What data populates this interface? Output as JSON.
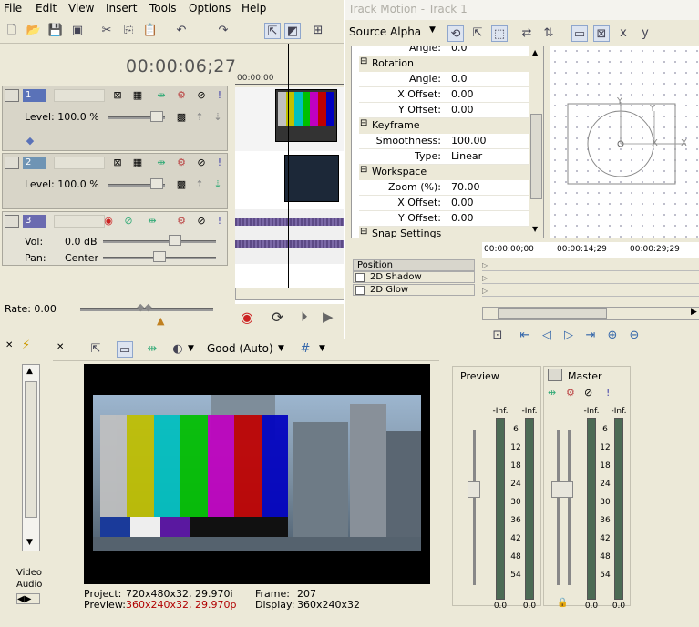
{
  "menu": [
    "File",
    "Edit",
    "View",
    "Insert",
    "Tools",
    "Options",
    "Help"
  ],
  "timecode": "00:00:06;27",
  "tracks": [
    {
      "num": "1",
      "level_label": "Level: 100.0 %",
      "color": "#5a72b8"
    },
    {
      "num": "2",
      "level_label": "Level: 100.0 %",
      "color": "#6f94b4"
    },
    {
      "num": "3",
      "vol_label": "Vol:",
      "vol_value": "0.0 dB",
      "pan_label": "Pan:",
      "pan_value": "Center",
      "color": "#6b6bb0"
    }
  ],
  "rate_label": "Rate: 0.00",
  "ruler_time": "00:00:00",
  "track_motion": {
    "title": "Track Motion - Track 1",
    "source_alpha": "Source Alpha",
    "props": [
      {
        "type": "partial",
        "key": "Angle:",
        "value": "0.0"
      },
      {
        "type": "cat",
        "label": "Rotation"
      },
      {
        "type": "prop",
        "key": "Angle:",
        "value": "0.0"
      },
      {
        "type": "prop",
        "key": "X Offset:",
        "value": "0.00"
      },
      {
        "type": "prop",
        "key": "Y Offset:",
        "value": "0.00"
      },
      {
        "type": "cat",
        "label": "Keyframe"
      },
      {
        "type": "prop",
        "key": "Smoothness:",
        "value": "100.00"
      },
      {
        "type": "prop",
        "key": "Type:",
        "value": "Linear"
      },
      {
        "type": "cat",
        "label": "Workspace"
      },
      {
        "type": "prop",
        "key": "Zoom (%):",
        "value": "70.00"
      },
      {
        "type": "prop",
        "key": "X Offset:",
        "value": "0.00"
      },
      {
        "type": "prop",
        "key": "Y Offset:",
        "value": "0.00"
      },
      {
        "type": "cat",
        "label": "Snap Settings"
      }
    ],
    "keyframe_times": [
      "00:00:00;00",
      "00:00:14;29",
      "00:00:29;29"
    ],
    "position_label": "Position",
    "checks": [
      "2D Shadow",
      "2D Glow"
    ],
    "axis_labels": [
      "Y",
      "Y",
      "X",
      "X"
    ]
  },
  "video_preview": {
    "quality": "Good (Auto)",
    "project_label": "Project:",
    "project_value": "720x480x32, 29.970i",
    "preview_label": "Preview:",
    "preview_value": "360x240x32, 29.970p",
    "frame_label": "Frame:",
    "frame_value": "207",
    "display_label": "Display:",
    "display_value": "360x240x32"
  },
  "explorer": {
    "video_label": "Video",
    "audio_label": "Audio"
  },
  "mixer": {
    "preview_label": "Preview",
    "master_label": "Master",
    "inf": "-Inf.",
    "scale": [
      "6",
      "12",
      "18",
      "24",
      "30",
      "36",
      "42",
      "48",
      "54"
    ],
    "zero": "0.0"
  },
  "colors": {
    "accent": "#316ac5",
    "red_text": "#b00000",
    "bars": [
      "#c0c0c0",
      "#c0c000",
      "#00c0c0",
      "#00c000",
      "#c000c0",
      "#c00000",
      "#0000c0"
    ]
  }
}
